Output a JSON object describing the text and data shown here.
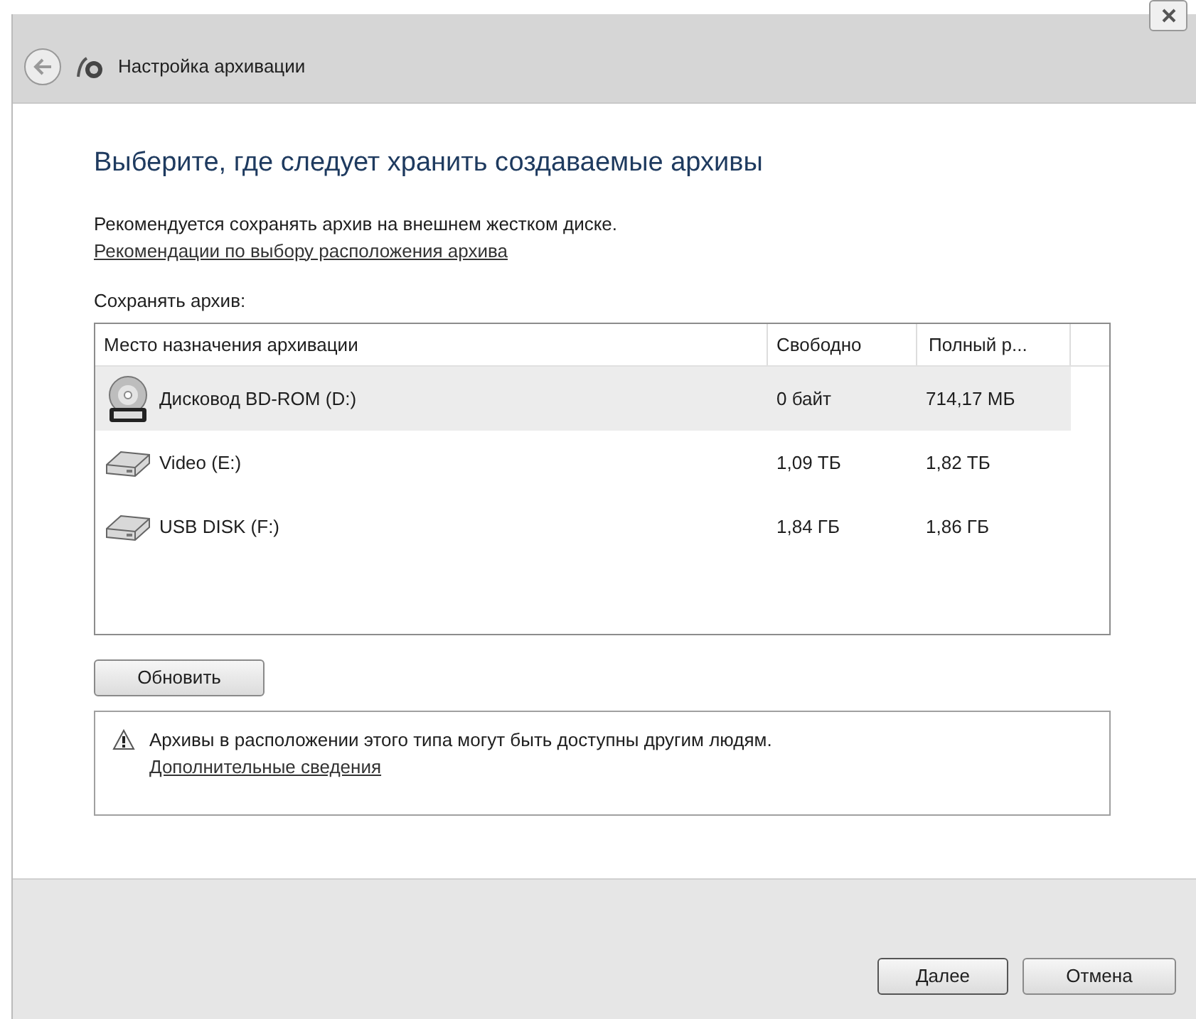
{
  "window": {
    "title": "Настройка архивации"
  },
  "heading": "Выберите, где следует хранить создаваемые архивы",
  "intro": {
    "text": "Рекомендуется сохранять архив на внешнем жестком диске.",
    "link": "Рекомендации по выбору расположения архива"
  },
  "list_label": "Сохранять архив:",
  "table": {
    "columns": [
      "Место назначения архивации",
      "Свободно",
      "Полный р..."
    ],
    "rows": [
      {
        "kind": "dvd",
        "name": "Дисковод BD-ROM (D:)",
        "free": "0 байт",
        "total": "714,17 МБ",
        "selected": true
      },
      {
        "kind": "drive",
        "name": "Video (E:)",
        "free": "1,09 ТБ",
        "total": "1,82 ТБ",
        "selected": false
      },
      {
        "kind": "drive",
        "name": "USB DISK (F:)",
        "free": "1,84 ГБ",
        "total": "1,86 ГБ",
        "selected": false
      }
    ]
  },
  "refresh_button": "Обновить",
  "notice": {
    "text": "Архивы в расположении этого типа могут быть доступны другим людям.",
    "link": "Дополнительные сведения"
  },
  "buttons": [
    "Далее",
    "Отмена"
  ]
}
